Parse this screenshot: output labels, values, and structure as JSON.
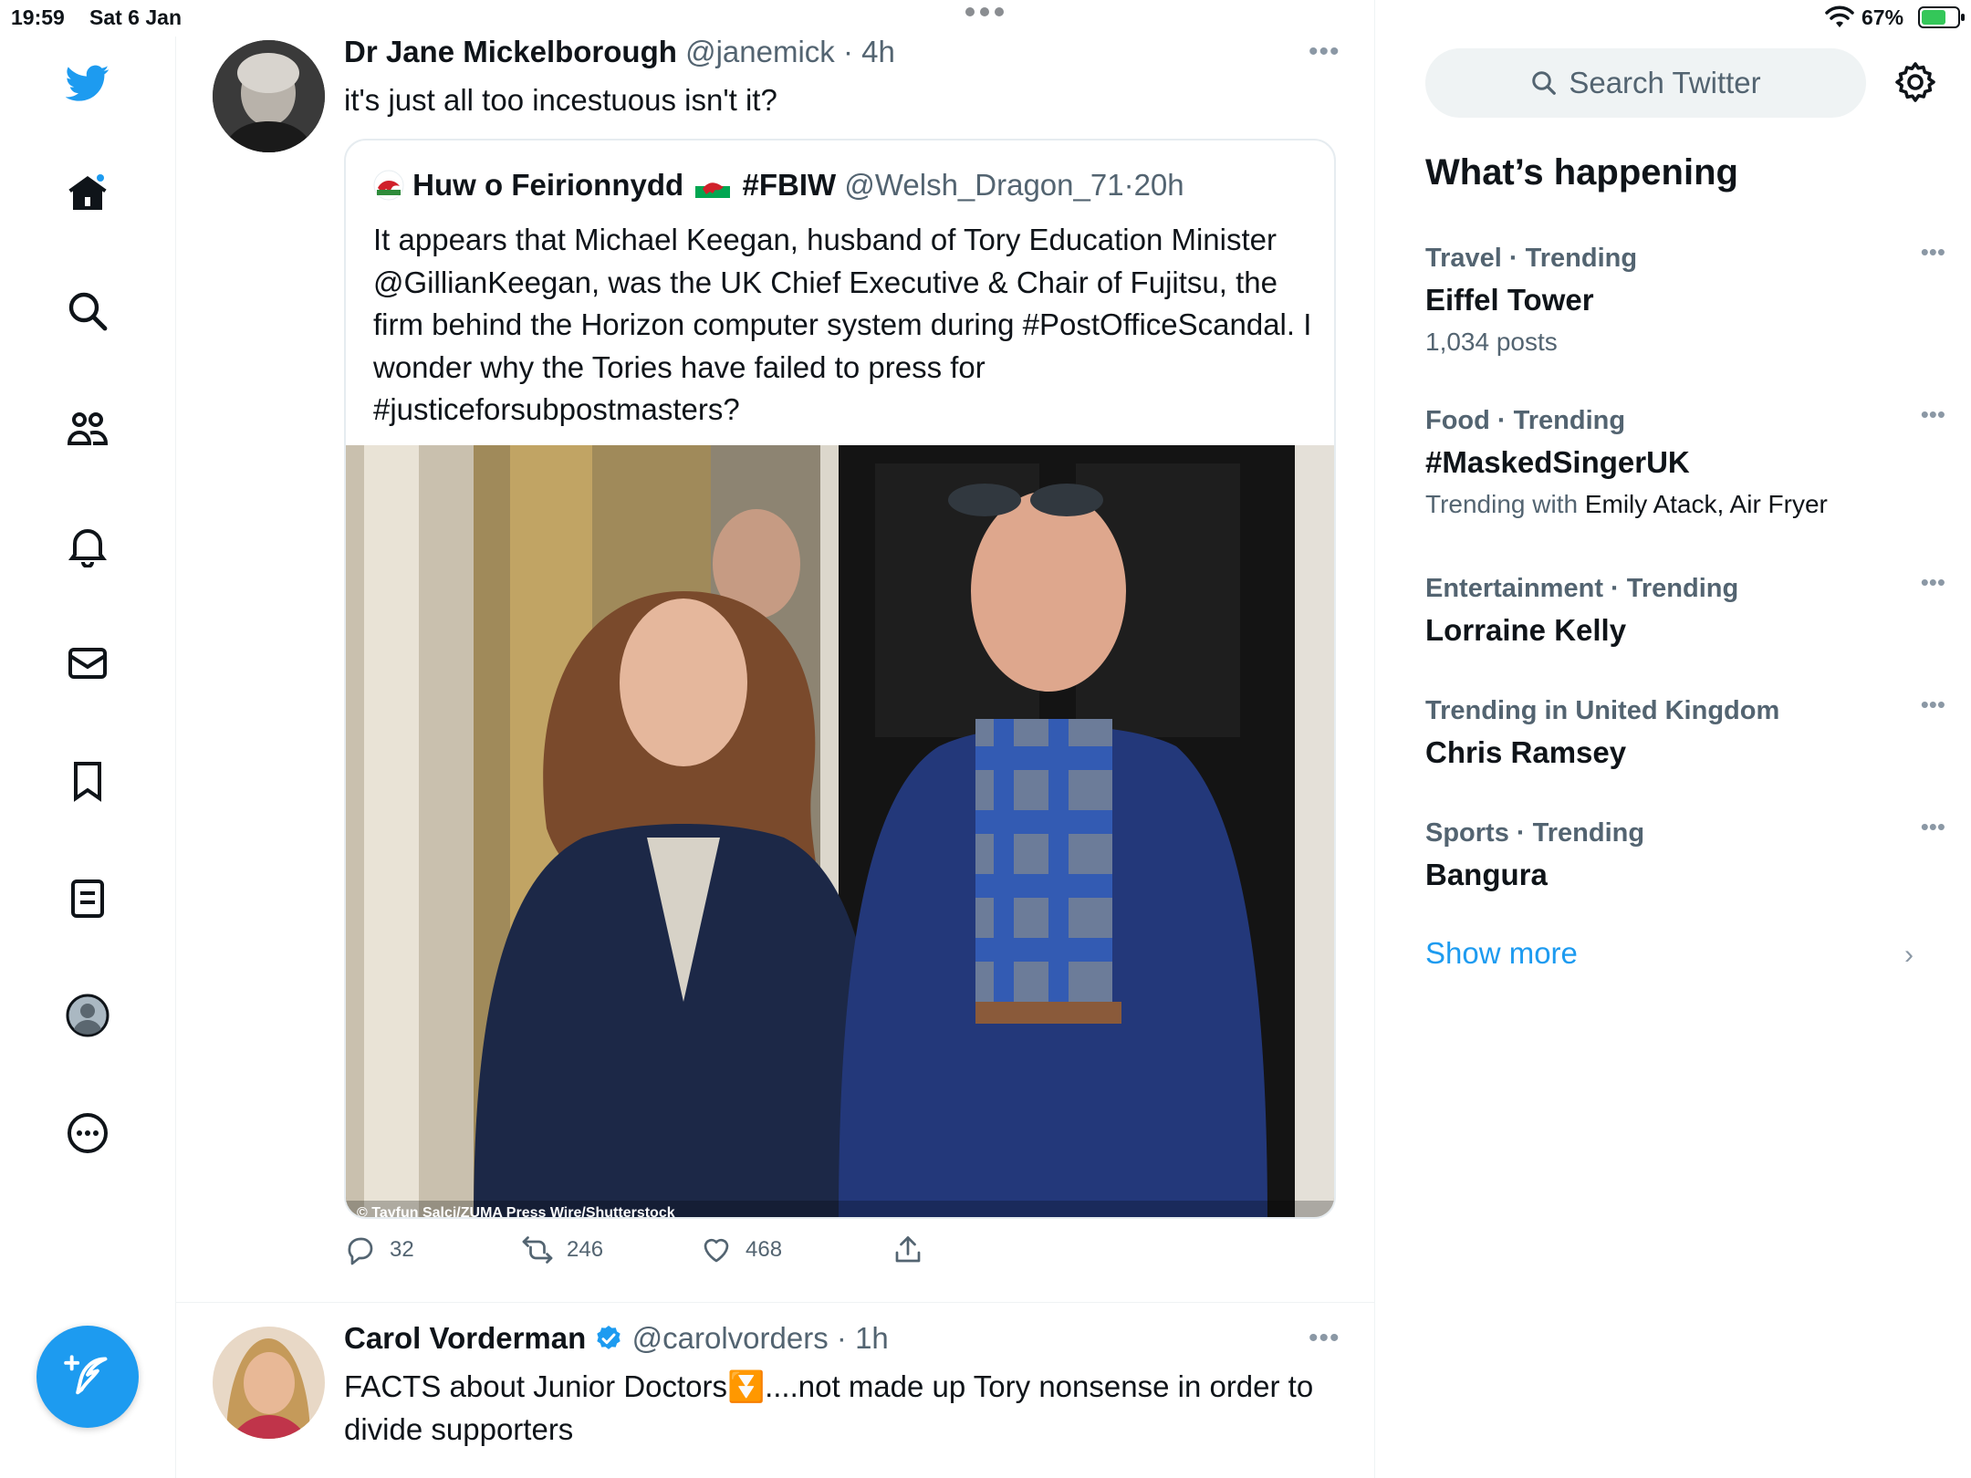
{
  "status": {
    "time": "19:59",
    "date": "Sat 6 Jan",
    "battery": "67%",
    "battery_level": 0.67
  },
  "colors": {
    "accent": "#1d9bf0",
    "text_primary": "#0f1419",
    "text_secondary": "#536471",
    "border": "#eff3f4"
  },
  "nav": [
    {
      "name": "twitter-logo-icon"
    },
    {
      "name": "home-icon"
    },
    {
      "name": "search-icon"
    },
    {
      "name": "communities-icon"
    },
    {
      "name": "notifications-icon"
    },
    {
      "name": "messages-icon"
    },
    {
      "name": "bookmarks-icon"
    },
    {
      "name": "lists-icon"
    },
    {
      "name": "profile-icon"
    },
    {
      "name": "more-icon"
    }
  ],
  "tweets": [
    {
      "name": "Dr Jane Mickelborough",
      "handle": "@janemick",
      "sep": "·",
      "time": "4h",
      "text": "it's just all too incestuous isn't it?",
      "quote": {
        "name": "Huw o Feirionnydd",
        "flag_tag": "#FBIW",
        "handle": "@Welsh_Dragon_71",
        "sep": "·",
        "time": "20h",
        "text": "It appears that Michael Keegan, husband of Tory Education Minister @GillianKeegan, was the UK Chief Executive & Chair of Fujitsu, the firm behind the Horizon computer system during #PostOfficeScandal. I wonder why the Tories have failed to press for #justiceforsubpostmasters?",
        "image_caption": "© Tayfun Salci/ZUMA Press Wire/Shutterstock"
      },
      "replies": "32",
      "retweets": "246",
      "likes": "468"
    },
    {
      "name": "Carol Vorderman",
      "handle": "@carolvorders",
      "sep": "·",
      "time": "1h",
      "text": "FACTS about Junior Doctors⏬....not made up Tory nonsense in order to divide supporters"
    }
  ],
  "sidebar": {
    "search_placeholder": "Search Twitter",
    "heading": "What’s happening",
    "trends": [
      {
        "category": "Travel · Trending",
        "title": "Eiffel Tower",
        "meta": "1,034 posts"
      },
      {
        "category": "Food · Trending",
        "title": "#MaskedSingerUK",
        "meta_prefix": "Trending with",
        "meta_with": "Emily Atack, Air Fryer"
      },
      {
        "category": "Entertainment · Trending",
        "title": "Lorraine Kelly"
      },
      {
        "category": "Trending in United Kingdom",
        "title": "Chris Ramsey"
      },
      {
        "category": "Sports · Trending",
        "title": "Bangura"
      }
    ],
    "show_more": "Show more"
  }
}
